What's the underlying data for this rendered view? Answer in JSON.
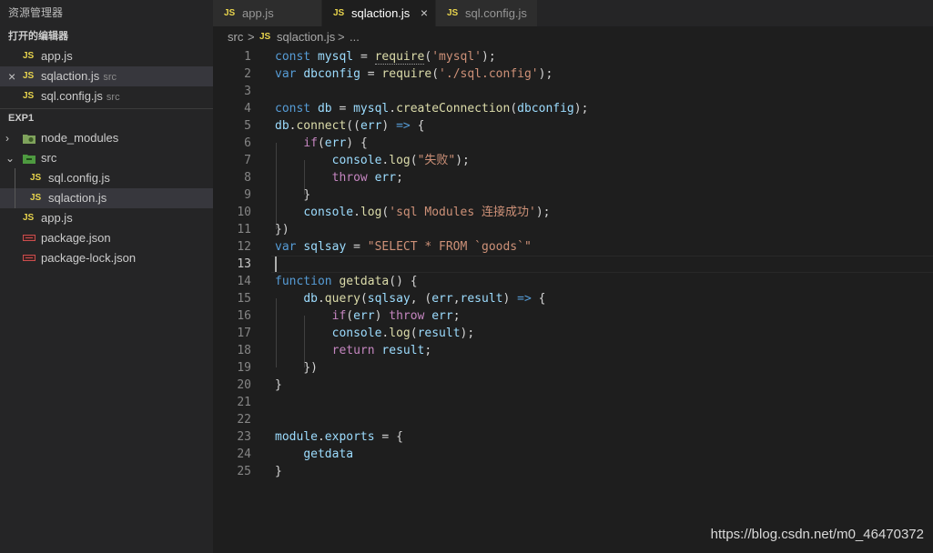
{
  "sidebar": {
    "title": "资源管理器",
    "open_editors": {
      "title": "打开的编辑器",
      "items": [
        {
          "icon": "JS",
          "name": "app.js",
          "folder": ""
        },
        {
          "icon": "JS",
          "name": "sqlaction.js",
          "folder": "src"
        },
        {
          "icon": "JS",
          "name": "sql.config.js",
          "folder": "src"
        }
      ]
    },
    "project": {
      "title": "EXP1",
      "tree": [
        {
          "name": "node_modules"
        },
        {
          "name": "src"
        },
        {
          "icon": "JS",
          "name": "sql.config.js"
        },
        {
          "icon": "JS",
          "name": "sqlaction.js"
        },
        {
          "icon": "JS",
          "name": "app.js"
        },
        {
          "name": "package.json"
        },
        {
          "name": "package-lock.json"
        }
      ]
    }
  },
  "tabs": [
    {
      "icon": "JS",
      "label": "app.js"
    },
    {
      "icon": "JS",
      "label": "sqlaction.js",
      "close": "×"
    },
    {
      "icon": "JS",
      "label": "sql.config.js"
    }
  ],
  "breadcrumb": {
    "folder": "src",
    "sep": ">",
    "icon": "JS",
    "file": "sqlaction.js",
    "more": "..."
  },
  "editor": {
    "line_numbers": [
      "1",
      "2",
      "3",
      "4",
      "5",
      "6",
      "7",
      "8",
      "9",
      "10",
      "11",
      "12",
      "13",
      "14",
      "15",
      "16",
      "17",
      "18",
      "19",
      "20",
      "21",
      "22",
      "23",
      "24",
      "25"
    ],
    "code_text": {
      "l1": "const mysql = require('mysql');",
      "l2": "var dbconfig = require('./sql.config');",
      "l4": "const db = mysql.createConnection(dbconfig);",
      "l5": "db.connect((err) => {",
      "l6": "    if(err) {",
      "l7": "        console.log(\"失败\");",
      "l8": "        throw err;",
      "l9": "    }",
      "l10": "    console.log('sql Modules 连接成功');",
      "l11": "})",
      "l12": "var sqlsay = \"SELECT * FROM `goods`\"",
      "l14": "function getdata() {",
      "l15": "    db.query(sqlsay, (err,result) => {",
      "l16": "        if(err) throw err;",
      "l17": "        console.log(result);",
      "l18": "        return result;",
      "l19": "    })",
      "l20": "}",
      "l23": "module.exports = {",
      "l24": "    getdata",
      "l25": "}"
    }
  },
  "watermark": "https://blog.csdn.net/m0_46470372",
  "colors": {
    "keyword": "#569cd6",
    "control": "#c586c0",
    "variable": "#9cdcfe",
    "function": "#dcdcaa",
    "string": "#ce9178",
    "js_icon": "#e8d44d"
  }
}
